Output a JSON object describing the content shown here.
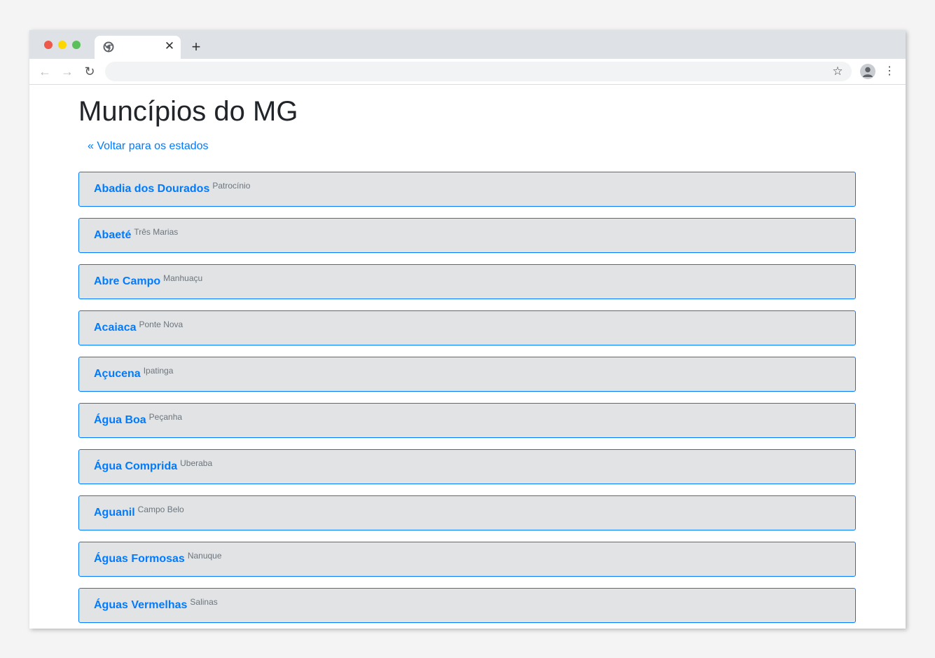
{
  "browser": {
    "tab_close": "✕",
    "new_tab": "+",
    "back": "←",
    "forward": "→",
    "reload": "↻",
    "bookmark": "☆",
    "menu": "⋮",
    "address": ""
  },
  "page": {
    "title": "Muncípios do MG",
    "back_link": "« Voltar para os estados"
  },
  "municipios": [
    {
      "name": "Abadia dos Dourados",
      "region": "Patrocínio"
    },
    {
      "name": "Abaeté",
      "region": "Três Marias"
    },
    {
      "name": "Abre Campo",
      "region": "Manhuaçu"
    },
    {
      "name": "Acaiaca",
      "region": "Ponte Nova"
    },
    {
      "name": "Açucena",
      "region": "Ipatinga"
    },
    {
      "name": "Água Boa",
      "region": "Peçanha"
    },
    {
      "name": "Água Comprida",
      "region": "Uberaba"
    },
    {
      "name": "Aguanil",
      "region": "Campo Belo"
    },
    {
      "name": "Águas Formosas",
      "region": "Nanuque"
    },
    {
      "name": "Águas Vermelhas",
      "region": "Salinas"
    }
  ],
  "colors": {
    "accent": "#007bff",
    "item_bg": "#e2e3e5",
    "muted": "#6c757d"
  }
}
